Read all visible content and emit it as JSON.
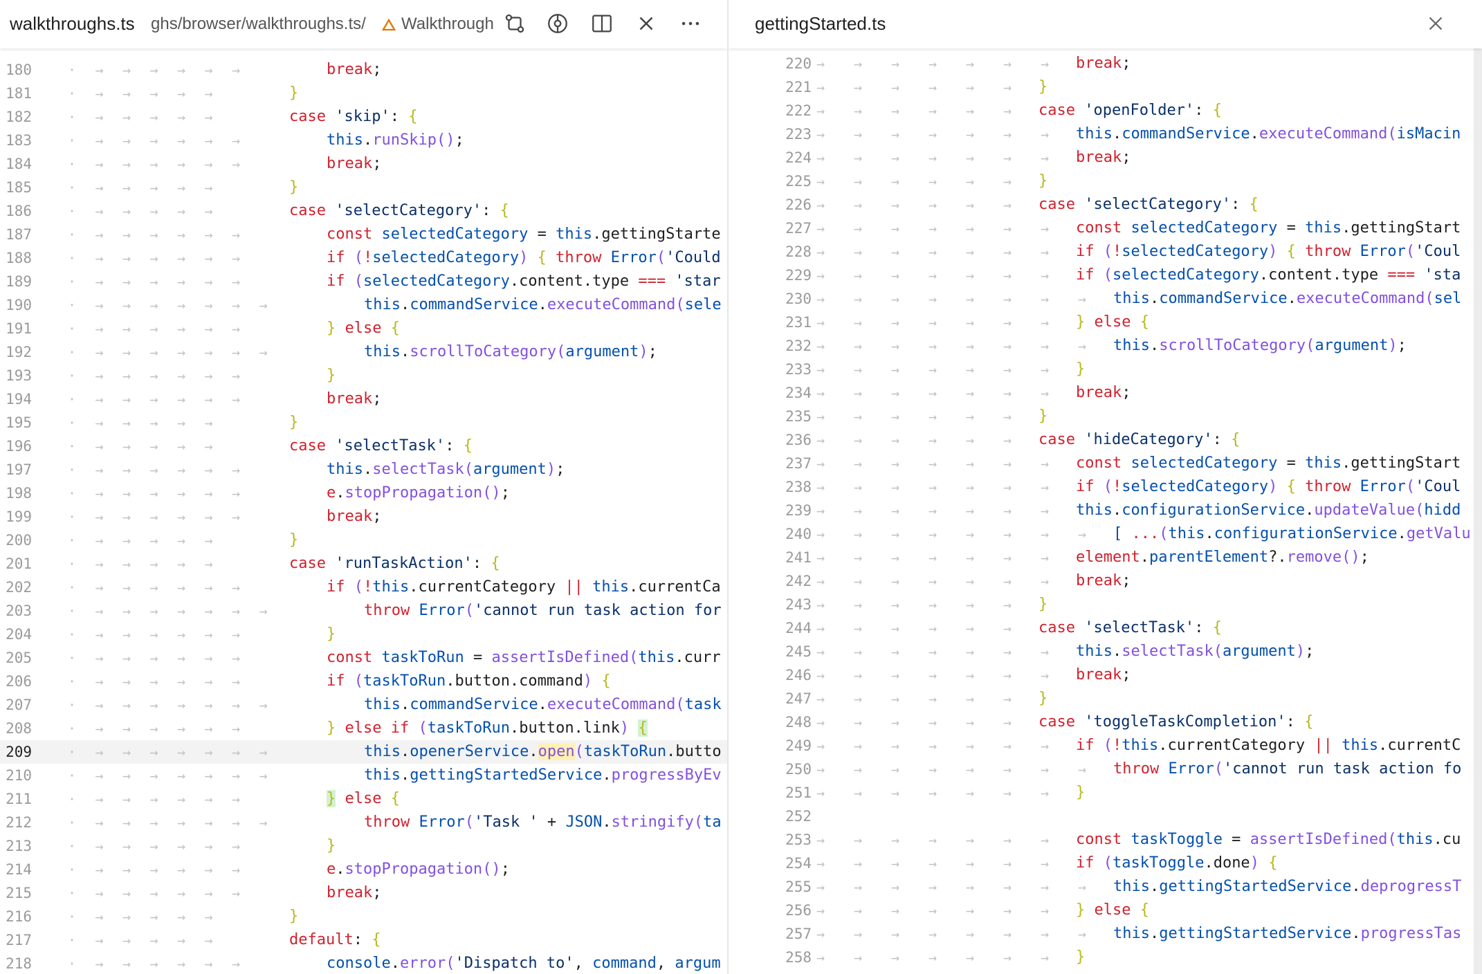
{
  "left": {
    "tab": {
      "title": "walkthroughs.ts",
      "path": "ghs/browser/walkthroughs.ts/",
      "symbol": "Walkthrough",
      "icons": [
        "branch-compare-icon",
        "git-commit-icon",
        "split-editor-icon",
        "close-icon",
        "more-actions-icon"
      ]
    },
    "current_line": 209,
    "lines": [
      {
        "n": "180",
        "html": "<span class=\"k\">break</span>;"
      },
      {
        "n": "181",
        "html": "<span class=\"b1\">}</span>"
      },
      {
        "n": "182",
        "html": "<span class=\"k\">case</span> <span class=\"s\">'skip'</span>: <span class=\"b1\">{</span>"
      },
      {
        "n": "183",
        "html": "<span class=\"v\">this</span>.<span class=\"f\">runSkip</span><span class=\"b2\">()</span>;"
      },
      {
        "n": "184",
        "html": "<span class=\"k\">break</span>;"
      },
      {
        "n": "185",
        "html": "<span class=\"b1\">}</span>"
      },
      {
        "n": "186",
        "html": "<span class=\"k\">case</span> <span class=\"s\">'selectCategory'</span>: <span class=\"b1\">{</span>"
      },
      {
        "n": "187",
        "html": "<span class=\"k\">const</span> <span class=\"v\">selectedCategory</span> = <span class=\"v\">this</span>.gettingStarte"
      },
      {
        "n": "188",
        "html": "<span class=\"k\">if</span> <span class=\"b2\">(</span><span class=\"o\">!</span><span class=\"v\">selectedCategory</span><span class=\"b2\">)</span> <span class=\"b1\">{</span> <span class=\"k\">throw</span> <span class=\"v\">Error</span><span class=\"b2\">(</span><span class=\"s\">'Could</span>"
      },
      {
        "n": "189",
        "html": "<span class=\"k\">if</span> <span class=\"b2\">(</span><span class=\"v\">selectedCategory</span>.content.type <span class=\"o\">===</span> <span class=\"s\">'star</span>"
      },
      {
        "n": "190",
        "html": "<span class=\"v\">this</span>.<span class=\"v\">commandService</span>.<span class=\"f\">executeCommand</span><span class=\"b2\">(</span><span class=\"v\">sele</span>"
      },
      {
        "n": "191",
        "html": "<span class=\"b1\">}</span> <span class=\"k\">else</span> <span class=\"b1\">{</span>"
      },
      {
        "n": "192",
        "html": "<span class=\"v\">this</span>.<span class=\"f\">scrollToCategory</span><span class=\"b2\">(</span><span class=\"v\">argument</span><span class=\"b2\">)</span>;"
      },
      {
        "n": "193",
        "html": "<span class=\"b1\">}</span>"
      },
      {
        "n": "194",
        "html": "<span class=\"k\">break</span>;"
      },
      {
        "n": "195",
        "html": "<span class=\"b1\">}</span>"
      },
      {
        "n": "196",
        "html": "<span class=\"k\">case</span> <span class=\"s\">'selectTask'</span>: <span class=\"b1\">{</span>"
      },
      {
        "n": "197",
        "html": "<span class=\"v\">this</span>.<span class=\"f\">selectTask</span><span class=\"b2\">(</span><span class=\"v\">argument</span><span class=\"b2\">)</span>;"
      },
      {
        "n": "198",
        "html": "<span class=\"k\">e</span>.<span class=\"f\">stopPropagation</span><span class=\"b2\">()</span>;"
      },
      {
        "n": "199",
        "html": "<span class=\"k\">break</span>;"
      },
      {
        "n": "200",
        "html": "<span class=\"b1\">}</span>"
      },
      {
        "n": "201",
        "html": "<span class=\"k\">case</span> <span class=\"s\">'runTaskAction'</span>: <span class=\"b1\">{</span>"
      },
      {
        "n": "202",
        "html": "<span class=\"k\">if</span> <span class=\"b2\">(</span><span class=\"o\">!</span><span class=\"v\">this</span>.currentCategory <span class=\"o\">||</span> <span class=\"v\">this</span>.currentCa"
      },
      {
        "n": "203",
        "html": "<span class=\"k\">throw</span> <span class=\"v\">Error</span><span class=\"b2\">(</span><span class=\"s\">'cannot run task action for</span>"
      },
      {
        "n": "204",
        "html": "<span class=\"b1\">}</span>"
      },
      {
        "n": "205",
        "html": "<span class=\"k\">const</span> <span class=\"v\">taskToRun</span> = <span class=\"f\">assertIsDefined</span><span class=\"b2\">(</span><span class=\"v\">this</span>.curr"
      },
      {
        "n": "206",
        "html": "<span class=\"k\">if</span> <span class=\"b2\">(</span><span class=\"v\">taskToRun</span>.button.command<span class=\"b2\">)</span> <span class=\"b1\">{</span>"
      },
      {
        "n": "207",
        "html": "<span class=\"v\">this</span>.<span class=\"v\">commandService</span>.<span class=\"f\">executeCommand</span><span class=\"b2\">(</span><span class=\"v\">task</span>"
      },
      {
        "n": "208",
        "html": "<span class=\"b1\">}</span> <span class=\"k\">else</span> <span class=\"k\">if</span> <span class=\"b2\">(</span><span class=\"v\">taskToRun</span>.button.link<span class=\"b2\">)</span> <span class=\"b1 mark\">{</span>"
      },
      {
        "n": "209",
        "html": "<span class=\"v\">this</span>.<span class=\"v\">openerService</span>.<span class=\"f hl\">open</span><span class=\"b2\">(</span><span class=\"v\">taskToRun</span>.butto"
      },
      {
        "n": "210",
        "html": "<span class=\"v\">this</span>.<span class=\"v\">gettingStartedService</span>.<span class=\"f\">progressByEv</span>"
      },
      {
        "n": "211",
        "html": "<span class=\"b1 mark\">}</span> <span class=\"k\">else</span> <span class=\"b1\">{</span>"
      },
      {
        "n": "212",
        "html": "<span class=\"k\">throw</span> <span class=\"v\">Error</span><span class=\"b2\">(</span><span class=\"s\">'Task '</span> + <span class=\"v\">JSON</span>.<span class=\"f\">stringify</span><span class=\"b2\">(</span><span class=\"v\">ta</span>"
      },
      {
        "n": "213",
        "html": "<span class=\"b1\">}</span>"
      },
      {
        "n": "214",
        "html": "<span class=\"k\">e</span>.<span class=\"f\">stopPropagation</span><span class=\"b2\">()</span>;"
      },
      {
        "n": "215",
        "html": "<span class=\"k\">break</span>;"
      },
      {
        "n": "216",
        "html": "<span class=\"b1\">}</span>"
      },
      {
        "n": "217",
        "html": "<span class=\"k\">default</span>: <span class=\"b1\">{</span>"
      },
      {
        "n": "218",
        "html": "<span class=\"v\">console</span>.<span class=\"f\">error</span><span class=\"b2\">(</span><span class=\"s\">'Dispatch to'</span>, <span class=\"v\">command</span>, <span class=\"v\">argum</span>"
      }
    ]
  },
  "right": {
    "tab": {
      "title": "gettingStarted.ts",
      "icons": [
        "close-icon"
      ]
    },
    "lines": [
      {
        "n": "220",
        "html": "<span class=\"k\">break</span>;"
      },
      {
        "n": "221",
        "html": "<span class=\"b1\">}</span>"
      },
      {
        "n": "222",
        "html": "<span class=\"k\">case</span> <span class=\"s\">'openFolder'</span>: <span class=\"b1\">{</span>"
      },
      {
        "n": "223",
        "html": "<span class=\"v\">this</span>.<span class=\"v\">commandService</span>.<span class=\"f\">executeCommand</span><span class=\"b2\">(</span><span class=\"v\">isMacin</span>"
      },
      {
        "n": "224",
        "html": "<span class=\"k\">break</span>;"
      },
      {
        "n": "225",
        "html": "<span class=\"b1\">}</span>"
      },
      {
        "n": "226",
        "html": "<span class=\"k\">case</span> <span class=\"s\">'selectCategory'</span>: <span class=\"b1\">{</span>"
      },
      {
        "n": "227",
        "html": "<span class=\"k\">const</span> <span class=\"v\">selectedCategory</span> = <span class=\"v\">this</span>.gettingStart"
      },
      {
        "n": "228",
        "html": "<span class=\"k\">if</span> <span class=\"b2\">(</span><span class=\"o\">!</span><span class=\"v\">selectedCategory</span><span class=\"b2\">)</span> <span class=\"b1\">{</span> <span class=\"k\">throw</span> <span class=\"v\">Error</span><span class=\"b2\">(</span><span class=\"s\">'Coul</span>"
      },
      {
        "n": "229",
        "html": "<span class=\"k\">if</span> <span class=\"b2\">(</span><span class=\"v\">selectedCategory</span>.content.type <span class=\"o\">===</span> <span class=\"s\">'sta</span>"
      },
      {
        "n": "230",
        "html": "<span class=\"v\">this</span>.<span class=\"v\">commandService</span>.<span class=\"f\">executeCommand</span><span class=\"b2\">(</span><span class=\"v\">sel</span>"
      },
      {
        "n": "231",
        "html": "<span class=\"b1\">}</span> <span class=\"k\">else</span> <span class=\"b1\">{</span>"
      },
      {
        "n": "232",
        "html": "<span class=\"v\">this</span>.<span class=\"f\">scrollToCategory</span><span class=\"b2\">(</span><span class=\"v\">argument</span><span class=\"b2\">)</span>;"
      },
      {
        "n": "233",
        "html": "<span class=\"b1\">}</span>"
      },
      {
        "n": "234",
        "html": "<span class=\"k\">break</span>;"
      },
      {
        "n": "235",
        "html": "<span class=\"b1\">}</span>"
      },
      {
        "n": "236",
        "html": "<span class=\"k\">case</span> <span class=\"s\">'hideCategory'</span>: <span class=\"b1\">{</span>"
      },
      {
        "n": "237",
        "html": "<span class=\"k\">const</span> <span class=\"v\">selectedCategory</span> = <span class=\"v\">this</span>.gettingStart"
      },
      {
        "n": "238",
        "html": "<span class=\"k\">if</span> <span class=\"b2\">(</span><span class=\"o\">!</span><span class=\"v\">selectedCategory</span><span class=\"b2\">)</span> <span class=\"b1\">{</span> <span class=\"k\">throw</span> <span class=\"v\">Error</span><span class=\"b2\">(</span><span class=\"s\">'Coul</span>"
      },
      {
        "n": "239",
        "html": "<span class=\"v\">this</span>.<span class=\"v\">configurationService</span>.<span class=\"f\">updateValue</span><span class=\"b2\">(</span><span class=\"v\">hidd</span>"
      },
      {
        "n": "240",
        "html": "<span class=\"v\">[</span> <span class=\"o\">...</span><span class=\"b2\">(</span><span class=\"v\">this</span>.<span class=\"v\">configurationService</span>.<span class=\"f\">getValu</span>"
      },
      {
        "n": "241",
        "html": "<span class=\"k\">element</span>.<span class=\"v\">parentElement</span>?.<span class=\"f\">remove</span><span class=\"b2\">()</span>;"
      },
      {
        "n": "242",
        "html": "<span class=\"k\">break</span>;"
      },
      {
        "n": "243",
        "html": "<span class=\"b1\">}</span>"
      },
      {
        "n": "244",
        "html": "<span class=\"k\">case</span> <span class=\"s\">'selectTask'</span>: <span class=\"b1\">{</span>"
      },
      {
        "n": "245",
        "html": "<span class=\"v\">this</span>.<span class=\"f\">selectTask</span><span class=\"b2\">(</span><span class=\"v\">argument</span><span class=\"b2\">)</span>;"
      },
      {
        "n": "246",
        "html": "<span class=\"k\">break</span>;"
      },
      {
        "n": "247",
        "html": "<span class=\"b1\">}</span>"
      },
      {
        "n": "248",
        "html": "<span class=\"k\">case</span> <span class=\"s\">'toggleTaskCompletion'</span>: <span class=\"b1\">{</span>"
      },
      {
        "n": "249",
        "html": "<span class=\"k\">if</span> <span class=\"b2\">(</span><span class=\"o\">!</span><span class=\"v\">this</span>.currentCategory <span class=\"o\">||</span> <span class=\"v\">this</span>.currentC"
      },
      {
        "n": "250",
        "html": "<span class=\"k\">throw</span> <span class=\"v\">Error</span><span class=\"b2\">(</span><span class=\"s\">'cannot run task action fo</span>"
      },
      {
        "n": "251",
        "html": "<span class=\"b1\">}</span>"
      },
      {
        "n": "252",
        "html": ""
      },
      {
        "n": "253",
        "html": "<span class=\"k\">const</span> <span class=\"v\">taskToggle</span> = <span class=\"f\">assertIsDefined</span><span class=\"b2\">(</span><span class=\"v\">this</span>.cu"
      },
      {
        "n": "254",
        "html": "<span class=\"k\">if</span> <span class=\"b2\">(</span><span class=\"v\">taskToggle</span>.done<span class=\"b2\">)</span> <span class=\"b1\">{</span>"
      },
      {
        "n": "255",
        "html": "<span class=\"v\">this</span>.<span class=\"v\">gettingStartedService</span>.<span class=\"f\">deprogressT</span>"
      },
      {
        "n": "256",
        "html": "<span class=\"b1\">}</span> <span class=\"k\">else</span> <span class=\"b1\">{</span>"
      },
      {
        "n": "257",
        "html": "<span class=\"v\">this</span>.<span class=\"v\">gettingStartedService</span>.<span class=\"f\">progressTas</span>"
      },
      {
        "n": "258",
        "html": "<span class=\"b1\">}</span>"
      }
    ]
  }
}
